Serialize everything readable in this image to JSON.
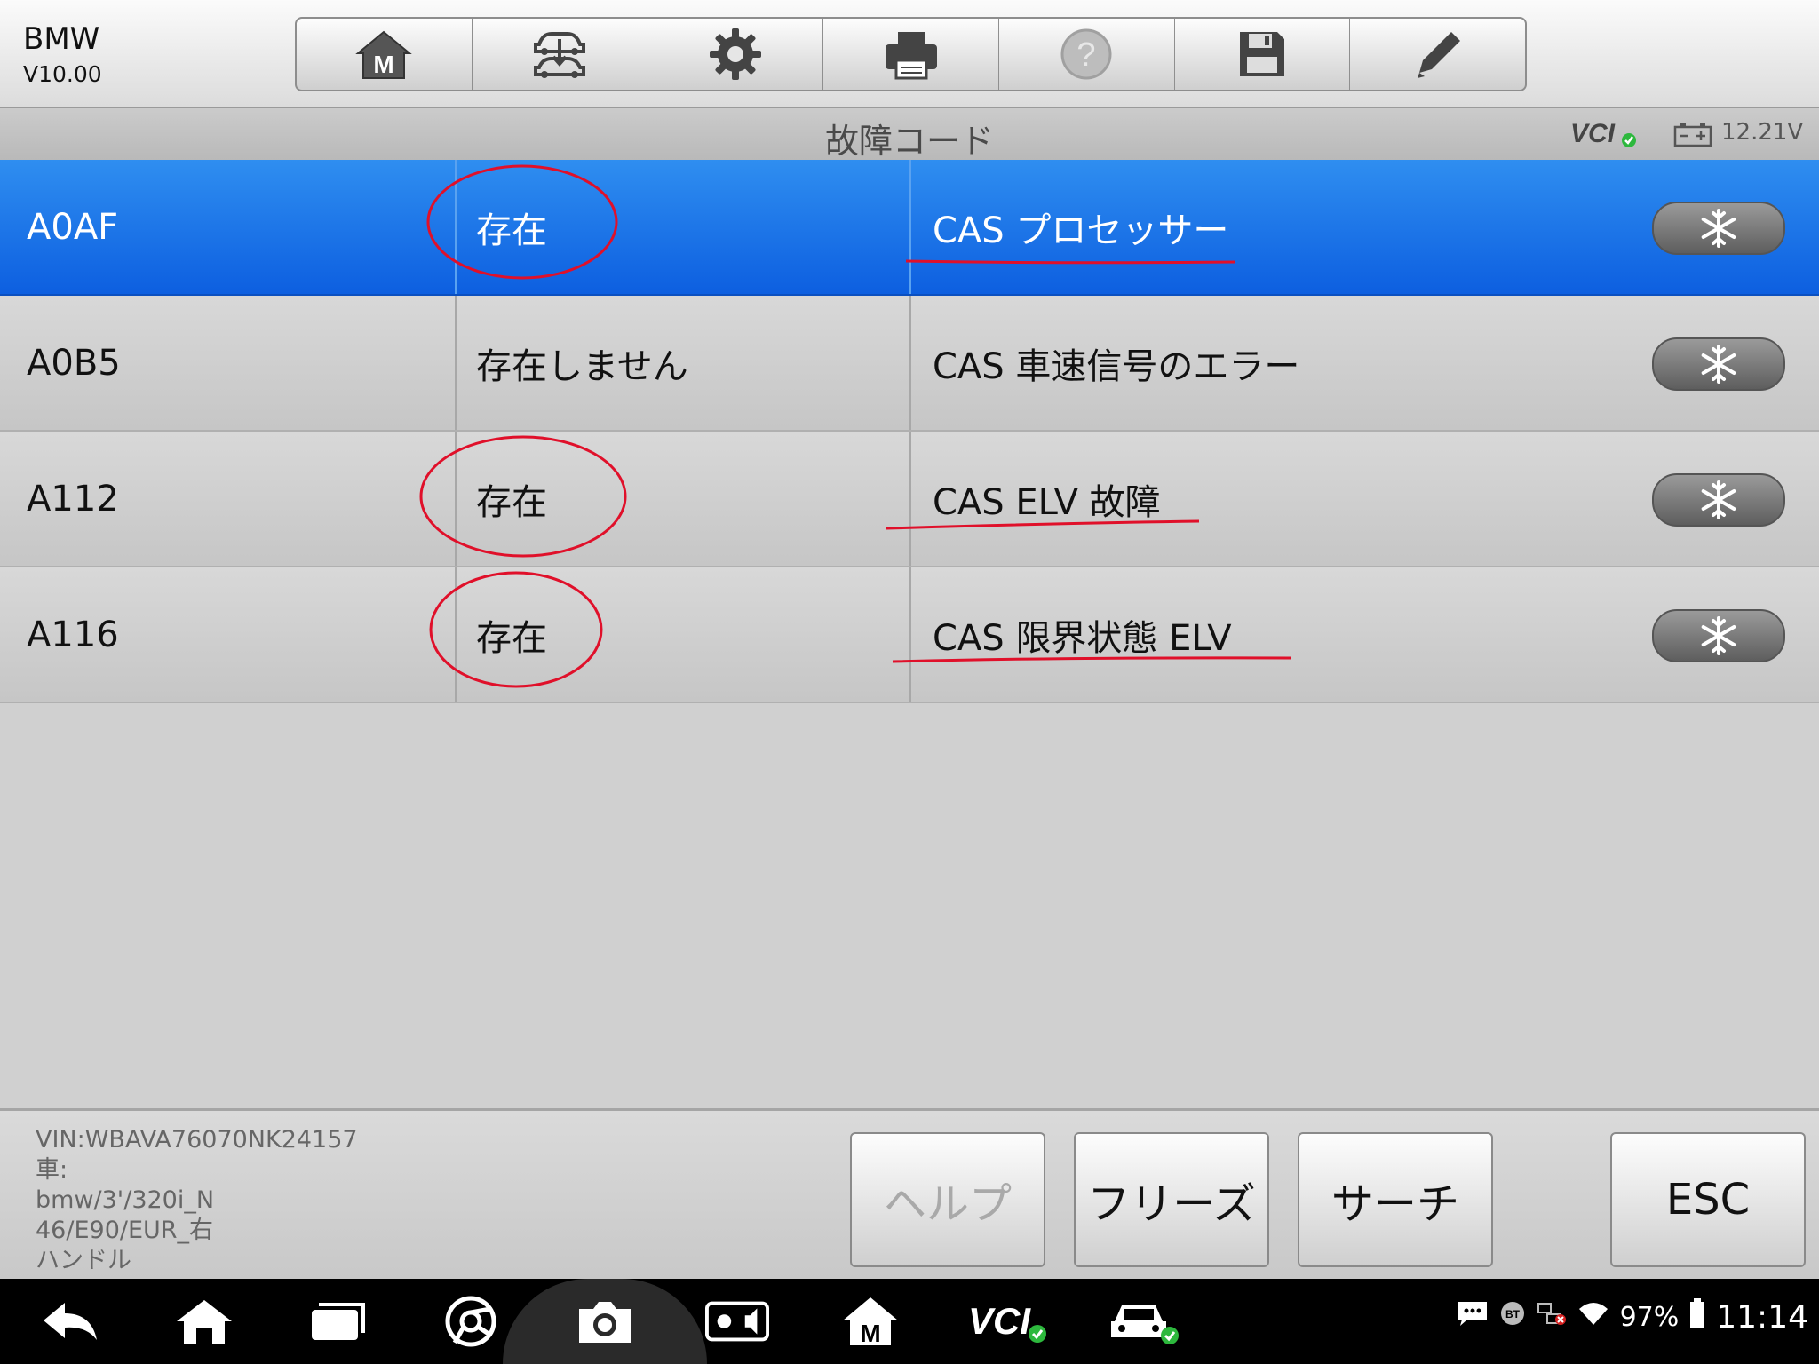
{
  "app": {
    "name": "BMW",
    "version": "V10.00"
  },
  "toolbar": {
    "buttons": [
      {
        "icon": "home-m-icon",
        "label": ""
      },
      {
        "icon": "vehicle-swap-icon",
        "label": ""
      },
      {
        "icon": "gear-icon",
        "label": ""
      },
      {
        "icon": "printer-icon",
        "label": ""
      },
      {
        "icon": "help-icon",
        "label": ""
      },
      {
        "icon": "save-icon",
        "label": ""
      },
      {
        "icon": "pencil-icon",
        "label": ""
      }
    ]
  },
  "titlebar": {
    "title": "故障コード",
    "vcl": "VCI",
    "voltage": "12.21V"
  },
  "dtc_rows": [
    {
      "code": "A0AF",
      "status": "存在",
      "description": "CAS プロセッサー",
      "selected": true
    },
    {
      "code": "A0B5",
      "status": "存在しません",
      "description": "CAS 車速信号のエラー",
      "selected": false
    },
    {
      "code": "A112",
      "status": "存在",
      "description": "CAS ELV 故障",
      "selected": false
    },
    {
      "code": "A116",
      "status": "存在",
      "description": "CAS 限界状態 ELV",
      "selected": false
    }
  ],
  "footer": {
    "vin": "VIN:WBAVA76070NK24157",
    "vehicle_label": "車:",
    "vehicle_line1": "bmw/3'/320i_N",
    "vehicle_line2": "46/E90/EUR_右",
    "vehicle_line3": "ハンドル",
    "buttons": {
      "help": "ヘルプ",
      "freeze": "フリーズ",
      "search": "サーチ",
      "esc": "ESC"
    }
  },
  "system": {
    "battery": "97%",
    "time": "11:14"
  },
  "colors": {
    "selected_row": "#1a73e8",
    "annotation_red": "#e0102a"
  }
}
